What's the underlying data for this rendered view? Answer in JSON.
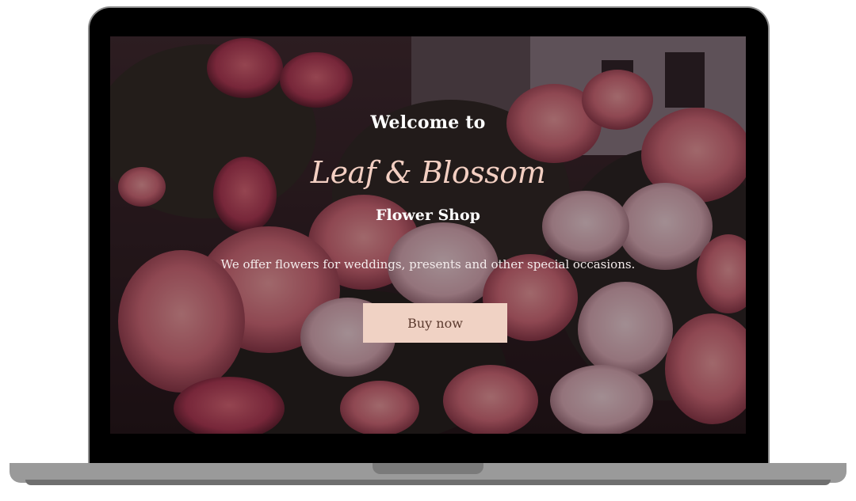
{
  "hero": {
    "welcome": "Welcome to",
    "brand": "Leaf & Blossom",
    "subtitle": "Flower Shop",
    "tagline": "We offer flowers for weddings, presents and other special occasions.",
    "cta_label": "Buy now"
  },
  "colors": {
    "brand_text": "#f3cfc2",
    "button_bg": "#f0d2c4",
    "button_text": "#5b3a2e",
    "device_frame": "#000000",
    "device_base": "#9a9a9a"
  },
  "images": {
    "background": "roses-photo"
  }
}
